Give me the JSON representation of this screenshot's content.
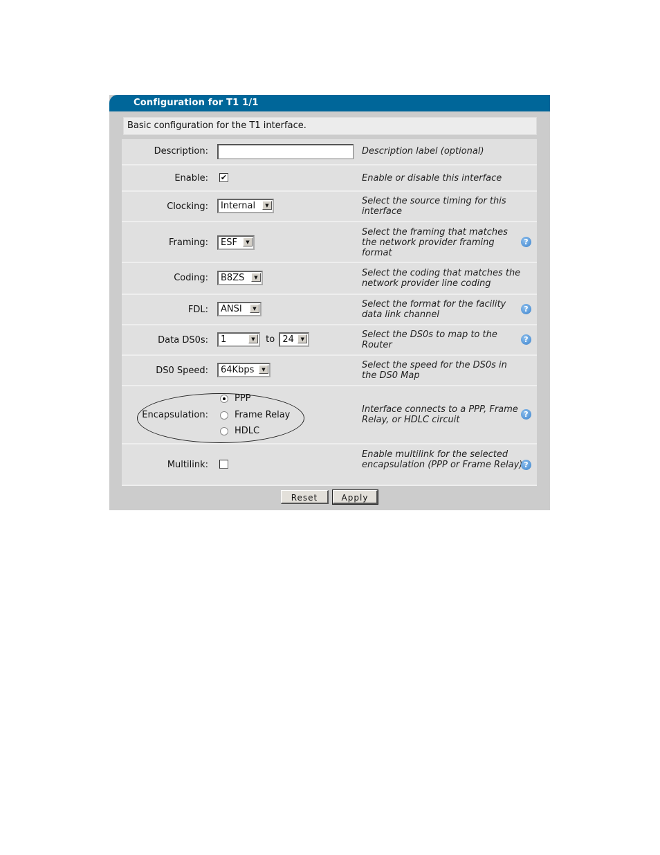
{
  "panel": {
    "title": "Configuration for T1 1/1",
    "intro": "Basic configuration for the T1 interface."
  },
  "fields": {
    "description": {
      "label": "Description:",
      "value": "",
      "hint": "Description label (optional)"
    },
    "enable": {
      "label": "Enable:",
      "checked": true,
      "check_glyph": "✔",
      "hint": "Enable or disable this interface"
    },
    "clocking": {
      "label": "Clocking:",
      "value": "Internal",
      "hint": "Select the source timing for this interface"
    },
    "framing": {
      "label": "Framing:",
      "value": "ESF",
      "hint": "Select the framing that matches the network provider framing format"
    },
    "coding": {
      "label": "Coding:",
      "value": "B8ZS",
      "hint": "Select the coding that matches the network provider line coding"
    },
    "fdl": {
      "label": "FDL:",
      "value": "ANSI",
      "hint": "Select the format for the facility data link channel"
    },
    "data_ds0s": {
      "label": "Data DS0s:",
      "from": "1",
      "to_label": "to",
      "to": "24",
      "hint": "Select the DS0s to map to the Router"
    },
    "ds0_speed": {
      "label": "DS0 Speed:",
      "value": "64Kbps",
      "hint": "Select the speed for the DS0s in the DS0 Map"
    },
    "encapsulation": {
      "label": "Encapsulation:",
      "options": [
        "PPP",
        "Frame Relay",
        "HDLC"
      ],
      "selected": "PPP",
      "hint": "Interface connects to a PPP, Frame Relay, or HDLC circuit"
    },
    "multilink": {
      "label": "Multilink:",
      "checked": false,
      "hint": "Enable multilink for the selected encapsulation (PPP or Frame Relay)"
    }
  },
  "icons": {
    "help": "?",
    "dropdown_arrow": "▼"
  },
  "buttons": {
    "reset": "Reset",
    "apply": "Apply"
  },
  "colors": {
    "title_bar": "#006699",
    "panel_bg": "#cccccc",
    "row_bg": "#e0e0e0",
    "help_icon": "#3a82cc"
  }
}
